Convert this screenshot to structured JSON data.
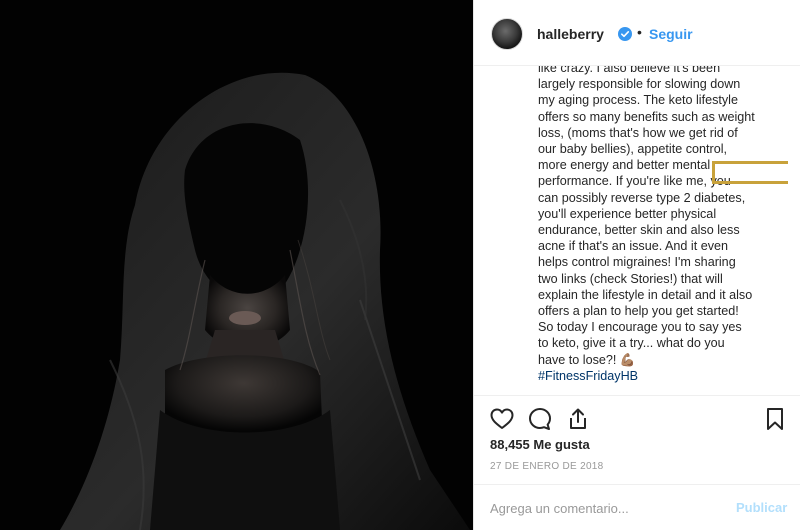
{
  "post": {
    "username": "halleberry",
    "dot": "•",
    "follow_label": "Seguir",
    "caption_lines": [
      "like crazy. I also believe it's been",
      "largely responsible for slowing down",
      "my aging process. The keto lifestyle",
      "offers so many benefits such as weight",
      "loss, (moms that's how we get rid of",
      "our baby bellies), appetite control,",
      "more energy and better mental",
      "performance. If you're like me, you",
      "can possibly reverse type 2 diabetes,",
      "you'll experience better physical",
      "endurance, better skin and also less",
      "acne if that's an issue. And it even",
      "helps control migraines! I'm sharing",
      "two links (check Stories!) that will",
      "explain the lifestyle in detail and it also",
      "offers a plan to help you get started!",
      "So today I encourage you to say yes",
      "to keto, give it a try... what do you",
      "have to lose?! 💪🏽"
    ],
    "hashtag": "#FitnessFridayHB",
    "likes": "88,455 Me gusta",
    "date": "27 DE ENERO DE 2018",
    "comment_placeholder": "Agrega un comentario...",
    "publish_label": "Publicar"
  },
  "icons": {
    "like": "heart-icon",
    "comment": "comment-icon",
    "share": "share-icon",
    "save": "bookmark-icon",
    "verified": "verified-badge-icon"
  },
  "colors": {
    "link_blue": "#3897f0",
    "highlight_box": "#c8a23b",
    "hashtag": "#003569"
  }
}
